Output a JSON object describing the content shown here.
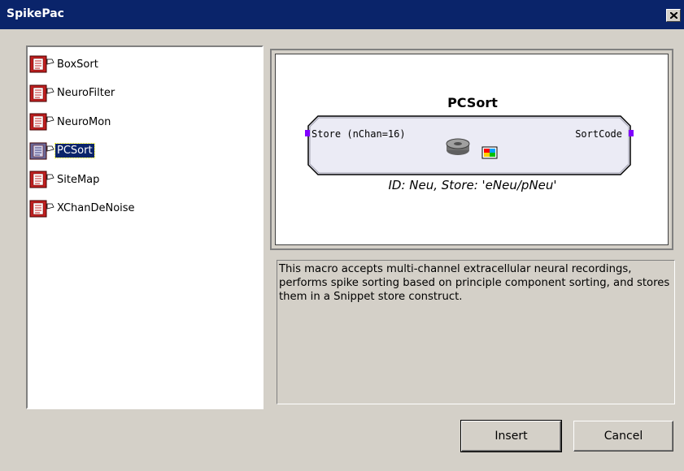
{
  "window": {
    "title": "SpikePac",
    "close_glyph": "✕"
  },
  "macro_list": {
    "items": [
      {
        "label": "BoxSort",
        "icon": "macro-icon",
        "selected": false
      },
      {
        "label": "NeuroFilter",
        "icon": "macro-icon",
        "selected": false
      },
      {
        "label": "NeuroMon",
        "icon": "macro-icon",
        "selected": false
      },
      {
        "label": "PCSort",
        "icon": "macro-icon",
        "selected": true
      },
      {
        "label": "SiteMap",
        "icon": "macro-icon",
        "selected": false
      },
      {
        "label": "XChanDeNoise",
        "icon": "macro-icon",
        "selected": false
      }
    ]
  },
  "preview": {
    "block_name": "PCSort",
    "input_port": "Store (nChan=16)",
    "output_port": "SortCode",
    "id_line": "ID: Neu,  Store: 'eNeu/pNeu'",
    "port_color": "#8000ff"
  },
  "description": "This macro accepts multi-channel extracellular neural recordings, performs spike sorting based on principle component sorting, and stores them in a Snippet store construct.",
  "buttons": {
    "insert": "Insert",
    "cancel": "Cancel"
  },
  "colors": {
    "titlebar": "#0a246a",
    "selection": "#0a246a",
    "face": "#d4d0c8"
  }
}
